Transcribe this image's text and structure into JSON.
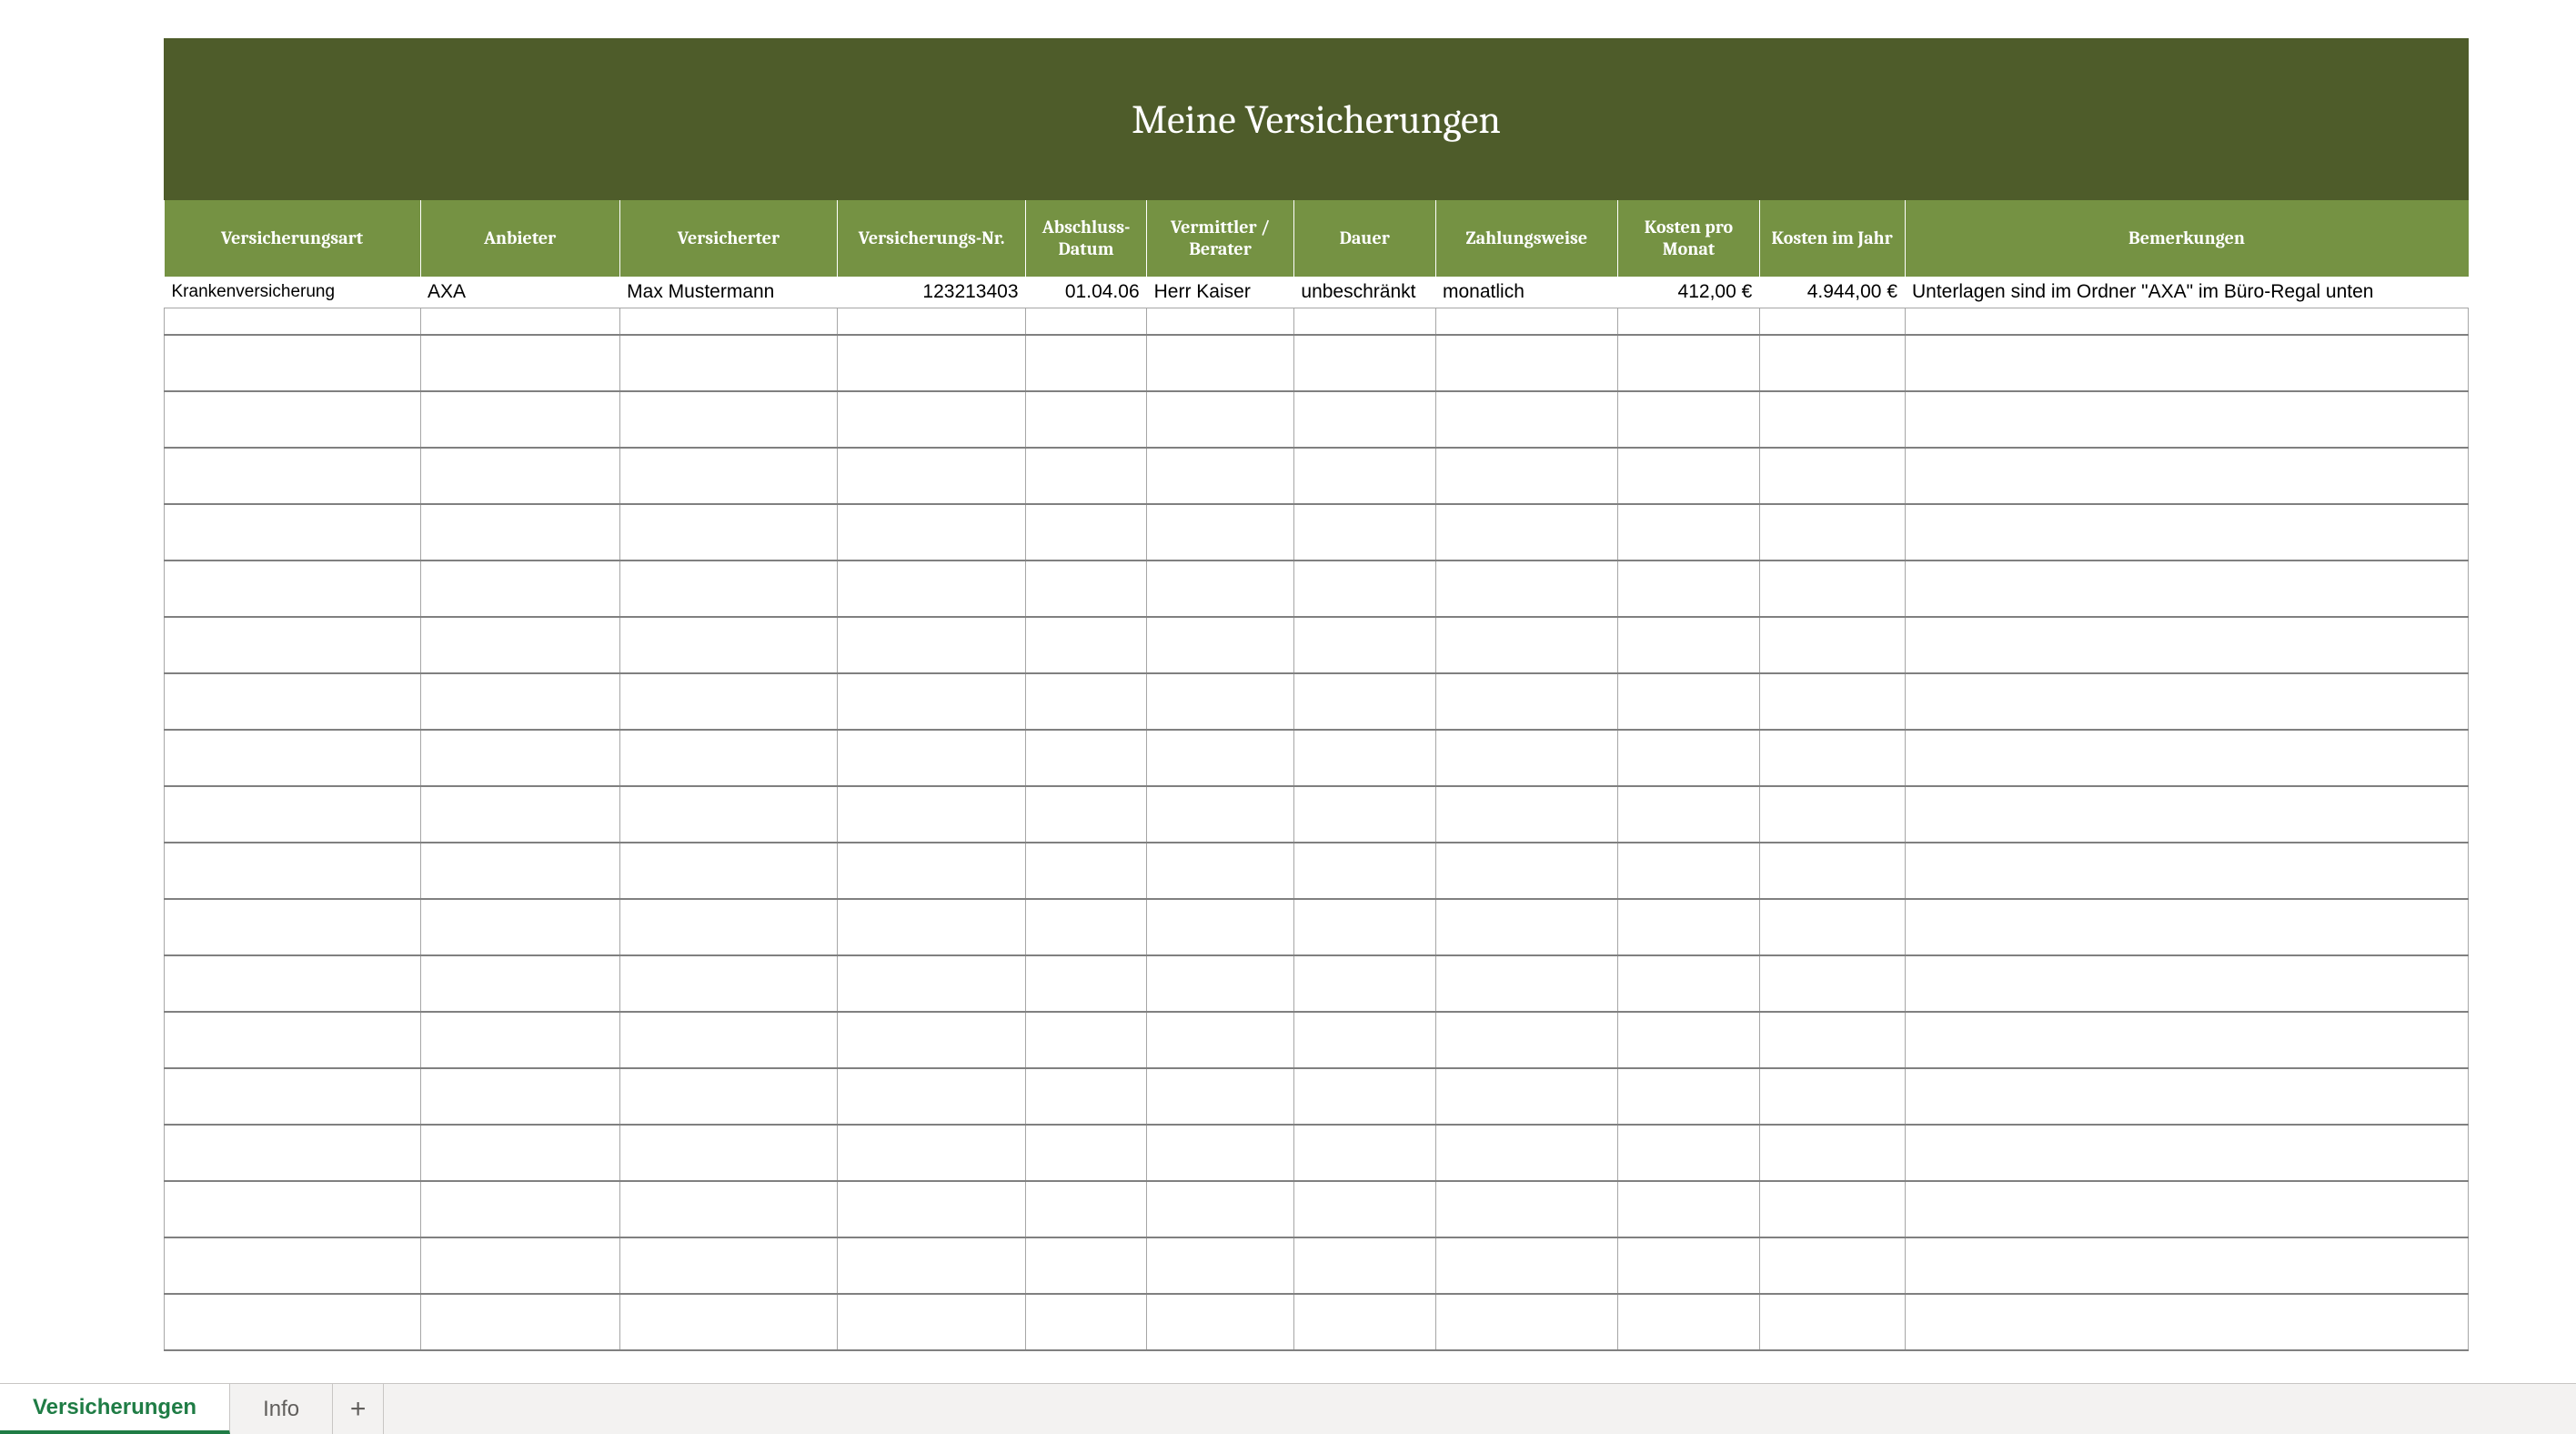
{
  "title": "Meine Versicherungen",
  "columns": [
    "Versicherungsart",
    "Anbieter",
    "Versicherter",
    "Versicherungs-Nr.",
    "Abschluss-Datum",
    "Vermittler / Berater",
    "Dauer",
    "Zahlungsweise",
    "Kosten pro Monat",
    "Kosten im Jahr",
    "Bemerkungen"
  ],
  "rows": [
    {
      "art": "Krankenversicherung",
      "anbieter": "AXA",
      "versicherter": "Max Mustermann",
      "nr": "123213403",
      "abschluss": "01.04.06",
      "vermittler": "Herr Kaiser",
      "dauer": "unbeschränkt",
      "zahlungsweise": "monatlich",
      "kosten_monat": "412,00 €",
      "kosten_jahr": "4.944,00 €",
      "bemerkungen": "Unterlagen sind im Ordner \"AXA\" im Büro-Regal unten"
    }
  ],
  "empty_rows": 18,
  "sheets": {
    "active": "Versicherungen",
    "other": "Info",
    "add": "+"
  }
}
